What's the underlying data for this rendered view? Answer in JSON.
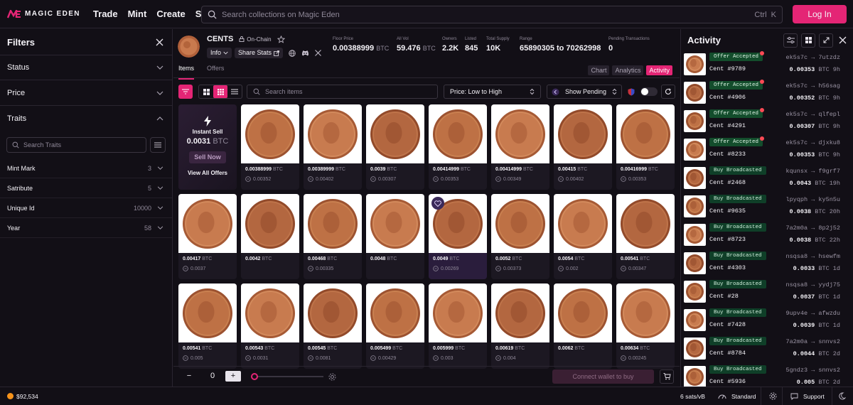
{
  "header": {
    "logo_text": "MAGIC EDEN",
    "nav": [
      "Trade",
      "Mint",
      "Create",
      "Swap"
    ],
    "search_placeholder": "Search collections on Magic Eden",
    "shortcut_label": "Ctrl",
    "shortcut_key": "K",
    "login_label": "Log In"
  },
  "filters": {
    "title": "Filters",
    "sections": [
      "Status",
      "Price",
      "Traits"
    ],
    "trait_search_placeholder": "Search Traits",
    "traits": [
      {
        "name": "Mint Mark",
        "count": "3"
      },
      {
        "name": "Satribute",
        "count": "5"
      },
      {
        "name": "Unique Id",
        "count": "10000"
      },
      {
        "name": "Year",
        "count": "58"
      }
    ]
  },
  "collection": {
    "name": "CENTS",
    "onchain_label": "On-Chain",
    "info_label": "Info",
    "share_label": "Share Stats",
    "stats": [
      {
        "label": "Floor Price",
        "value": "0.00388999",
        "unit": "BTC"
      },
      {
        "label": "All Vol",
        "value": "59.476",
        "unit": "BTC"
      },
      {
        "label": "Owners",
        "value": "2.2K",
        "unit": ""
      },
      {
        "label": "Listed",
        "value": "845",
        "unit": ""
      },
      {
        "label": "Total Supply",
        "value": "10K",
        "unit": ""
      },
      {
        "label": "Range",
        "value": "65890305 to 70262998",
        "unit": ""
      },
      {
        "label": "Pending Transactions",
        "value": "0",
        "unit": ""
      }
    ],
    "tabs": [
      "Items",
      "Offers"
    ],
    "view_tabs": [
      "Chart",
      "Analytics",
      "Activity"
    ]
  },
  "toolbar": {
    "search_placeholder": "Search items",
    "sort_label": "Price: Low to High",
    "pending_label": "Show Pending"
  },
  "instant_sell": {
    "title": "Instant Sell",
    "value": "0.0031",
    "unit": "BTC",
    "button": "Sell Now",
    "link": "View All Offers"
  },
  "items": [
    {
      "price": "0.00388999",
      "offer": "0.00352"
    },
    {
      "price": "0.00389999",
      "offer": "0.00402"
    },
    {
      "price": "0.0039",
      "offer": "0.00307"
    },
    {
      "price": "0.00414999",
      "offer": "0.00353"
    },
    {
      "price": "0.00414999",
      "offer": "0.00349"
    },
    {
      "price": "0.00415",
      "offer": "0.00402"
    },
    {
      "price": "0.00416999",
      "offer": "0.00353"
    },
    {
      "price": "0.00417",
      "offer": "0.0037"
    },
    {
      "price": "0.0042",
      "offer": ""
    },
    {
      "price": "0.00468",
      "offer": "0.00335"
    },
    {
      "price": "0.0048",
      "offer": ""
    },
    {
      "price": "0.0049",
      "offer": "0.00269"
    },
    {
      "price": "0.0052",
      "offer": "0.00373"
    },
    {
      "price": "0.0054",
      "offer": "0.002"
    },
    {
      "price": "0.00541",
      "offer": "0.00347"
    },
    {
      "price": "0.00541",
      "offer": "0.005"
    },
    {
      "price": "0.00543",
      "offer": "0.0031"
    },
    {
      "price": "0.00545",
      "offer": "0.0081"
    },
    {
      "price": "0.005499",
      "offer": "0.00429"
    },
    {
      "price": "0.005999",
      "offer": "0.003"
    },
    {
      "price": "0.00619",
      "offer": "0.004"
    },
    {
      "price": "0.0062",
      "offer": ""
    },
    {
      "price": "0.00634",
      "offer": "0.00245"
    }
  ],
  "unit": "BTC",
  "bottom": {
    "qty": "0",
    "minus": "−",
    "plus": "+",
    "connect_label": "Connect wallet to buy"
  },
  "activity": {
    "title": "Activity",
    "rows": [
      {
        "badge": "Offer Accepted",
        "name": "Cent #9789",
        "from": "ek5s7c",
        "to": "7utzdz",
        "price": "0.00353",
        "time": "9h"
      },
      {
        "badge": "Offer Accepted",
        "name": "Cent #4906",
        "from": "ek5s7c",
        "to": "h56sag",
        "price": "0.00352",
        "time": "9h"
      },
      {
        "badge": "Offer Accepted",
        "name": "Cent #4291",
        "from": "ek5s7c",
        "to": "qlfepl",
        "price": "0.00307",
        "time": "9h"
      },
      {
        "badge": "Offer Accepted",
        "name": "Cent #8233",
        "from": "ek5s7c",
        "to": "djxku8",
        "price": "0.00353",
        "time": "9h"
      },
      {
        "badge": "Buy Broadcasted",
        "name": "Cent #2468",
        "from": "kqunsx",
        "to": "f9grf7",
        "price": "0.0043",
        "time": "19h"
      },
      {
        "badge": "Buy Broadcasted",
        "name": "Cent #9635",
        "from": "lpyqph",
        "to": "ky5n5u",
        "price": "0.0038",
        "time": "20h"
      },
      {
        "badge": "Buy Broadcasted",
        "name": "Cent #8723",
        "from": "7a2m0a",
        "to": "8p2j52",
        "price": "0.0038",
        "time": "22h"
      },
      {
        "badge": "Buy Broadcasted",
        "name": "Cent #4303",
        "from": "nsqsa8",
        "to": "hsewfm",
        "price": "0.0033",
        "time": "1d"
      },
      {
        "badge": "Buy Broadcasted",
        "name": "Cent #28",
        "from": "nsqsa8",
        "to": "yydj75",
        "price": "0.0037",
        "time": "1d"
      },
      {
        "badge": "Buy Broadcasted",
        "name": "Cent #7428",
        "from": "9upv4e",
        "to": "afwzdu",
        "price": "0.0039",
        "time": "1d"
      },
      {
        "badge": "Buy Broadcasted",
        "name": "Cent #8784",
        "from": "7a2m0a",
        "to": "snnvs2",
        "price": "0.0044",
        "time": "2d"
      },
      {
        "badge": "Buy Broadcasted",
        "name": "Cent #5936",
        "from": "5gndz3",
        "to": "snnvs2",
        "price": "0.005",
        "time": "2d"
      }
    ]
  },
  "footer": {
    "btc_price": "$92,534",
    "fee": "6 sats/vB",
    "speed": "Standard",
    "support": "Support"
  },
  "colors": {
    "accent": "#e42575",
    "background": "#120f16",
    "success": "#134d2c"
  }
}
